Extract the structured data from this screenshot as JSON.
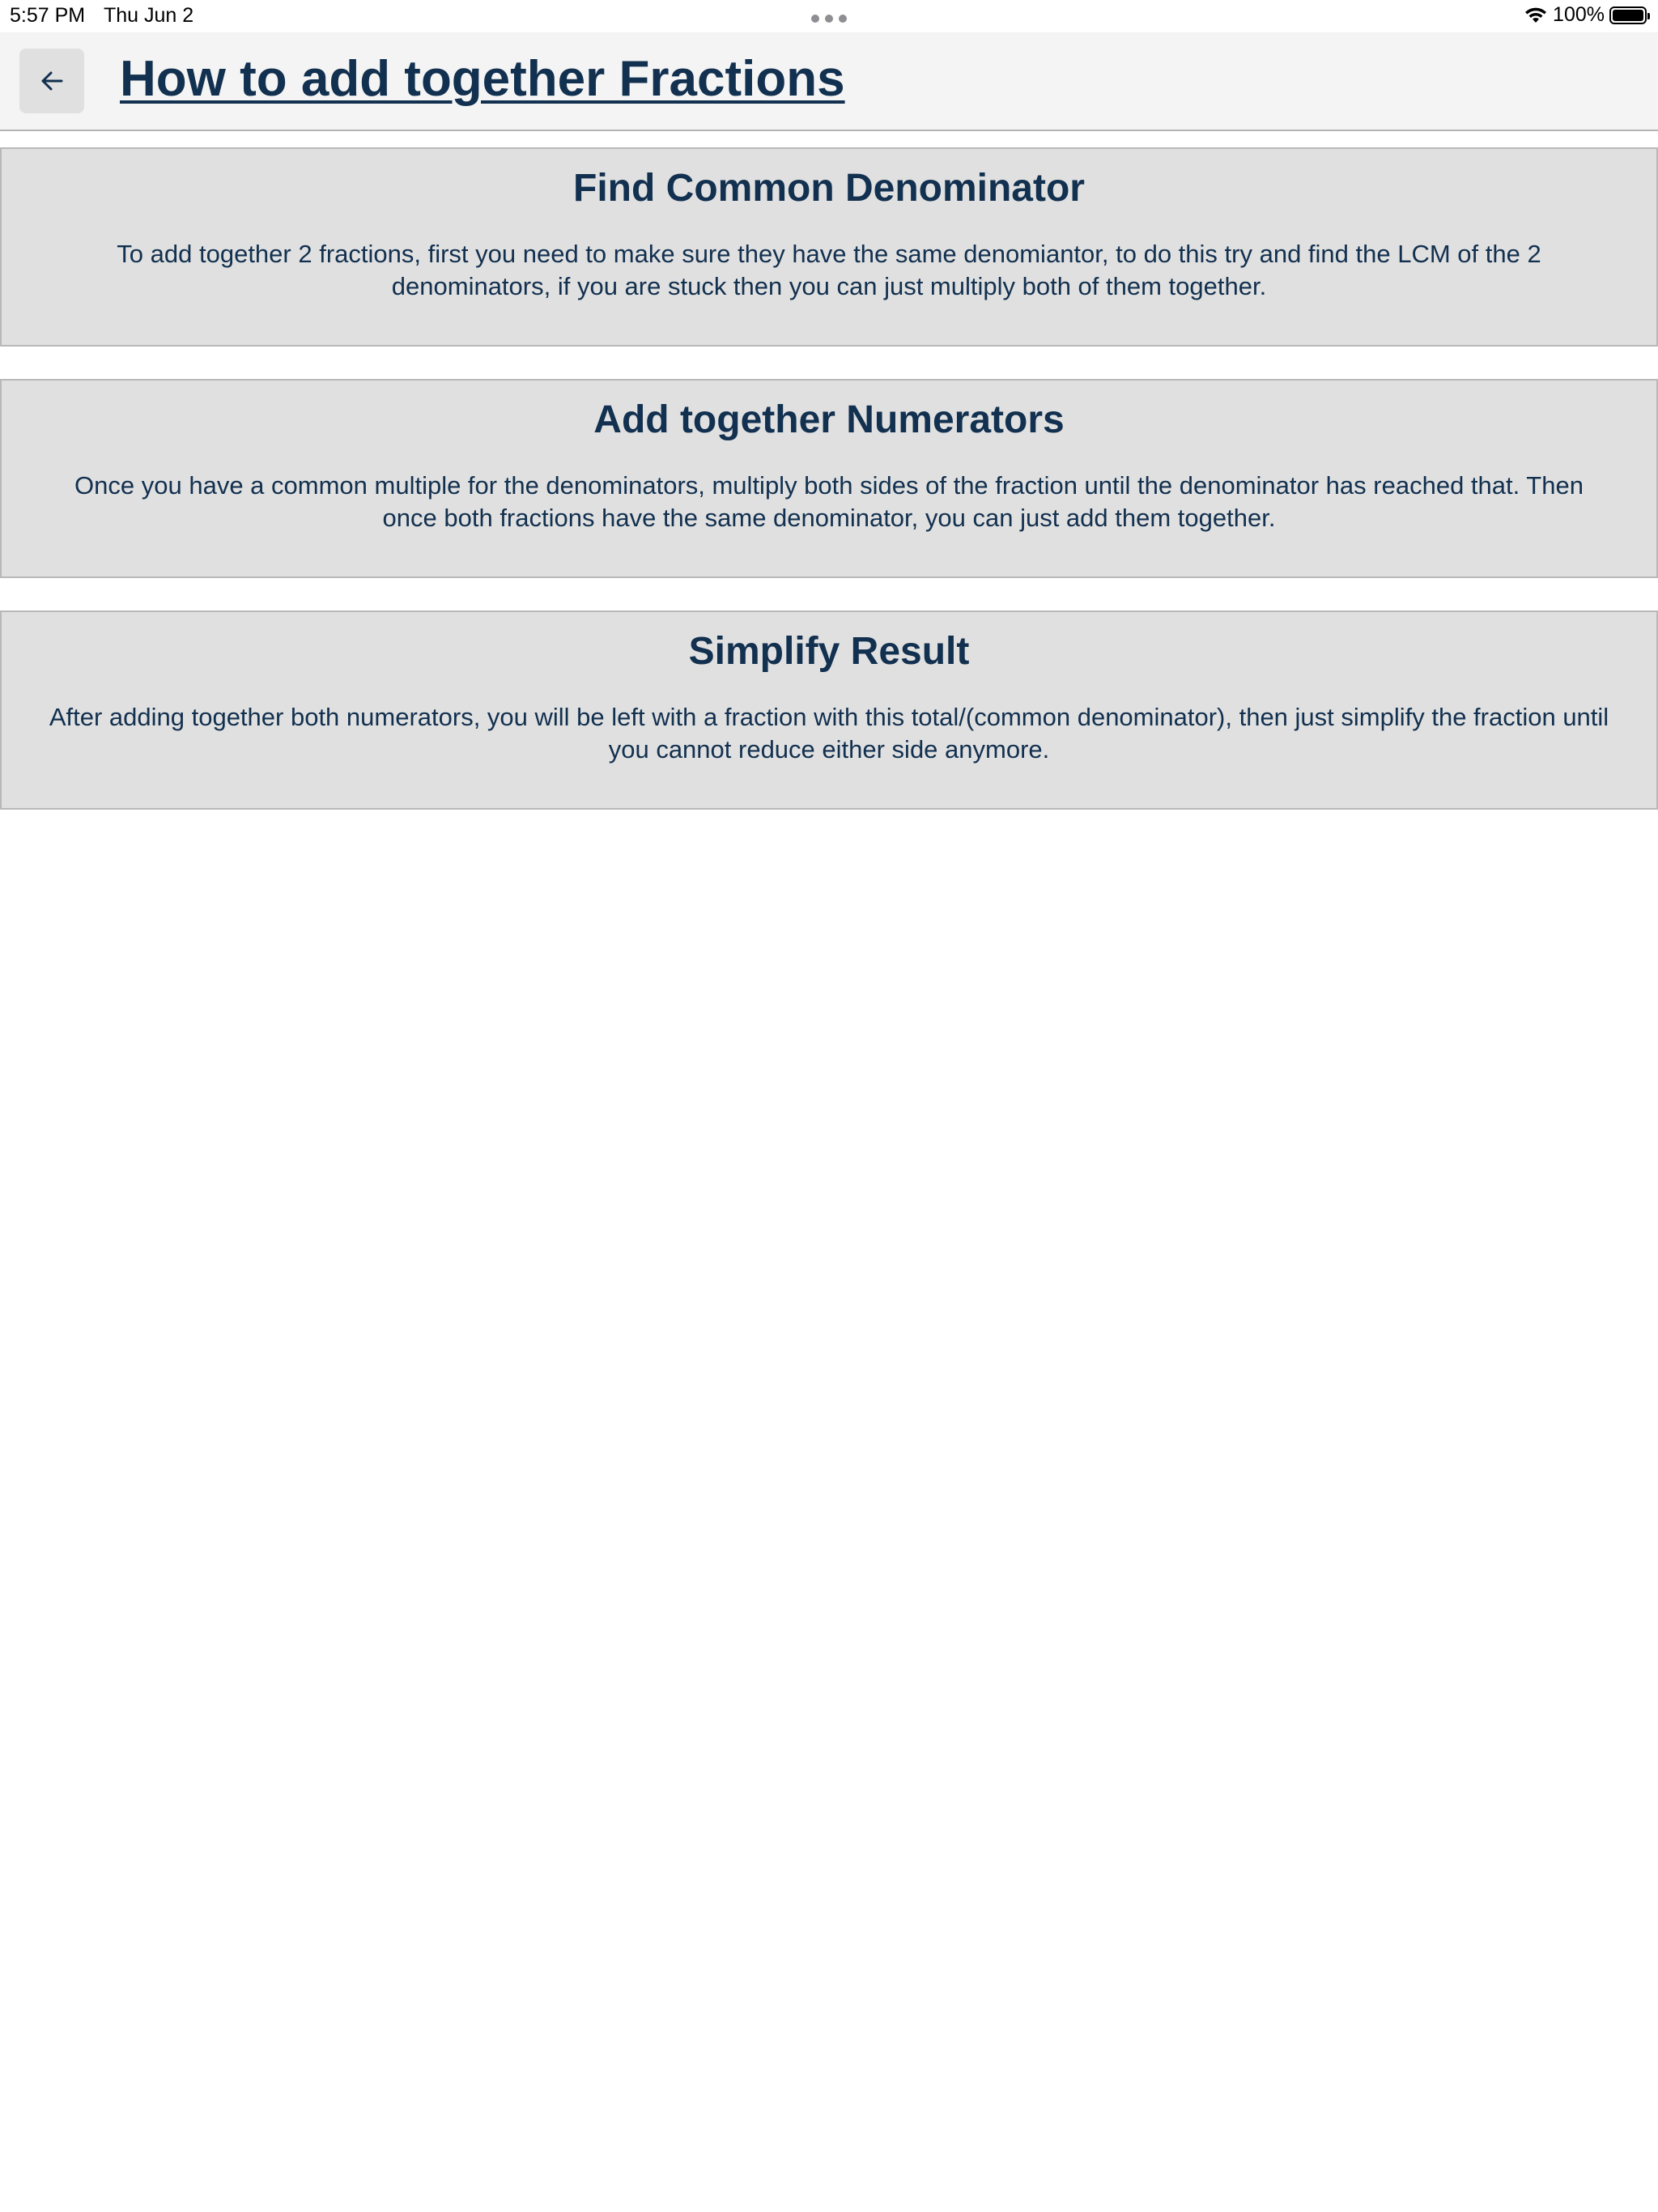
{
  "status_bar": {
    "time": "5:57 PM",
    "date": "Thu Jun 2",
    "battery": "100%",
    "battery_level": 1.0
  },
  "header": {
    "back_icon": "arrow-left-icon",
    "title": "How to add together Fractions"
  },
  "cards": [
    {
      "heading": "Find Common Denominator",
      "body": "To add together 2 fractions, first you need to make sure they have the same denomiantor, to do this try and find the LCM of the 2 denominators, if you are stuck then you can just multiply both of them together."
    },
    {
      "heading": "Add together Numerators",
      "body": "Once you have a common multiple for the denominators, multiply both sides of the fraction until the denominator has reached that. Then once both fractions have the same denominator, you can just add them together."
    },
    {
      "heading": "Simplify Result",
      "body": "After adding together both numerators, you will be left with a fraction with this total/(common denominator), then just simplify the fraction until you cannot reduce either side anymore."
    }
  ],
  "colors": {
    "title_text": "#12304f",
    "header_bg": "#f4f4f4",
    "card_bg": "#e0e0e0",
    "back_button_bg": "#e0e0e0"
  }
}
